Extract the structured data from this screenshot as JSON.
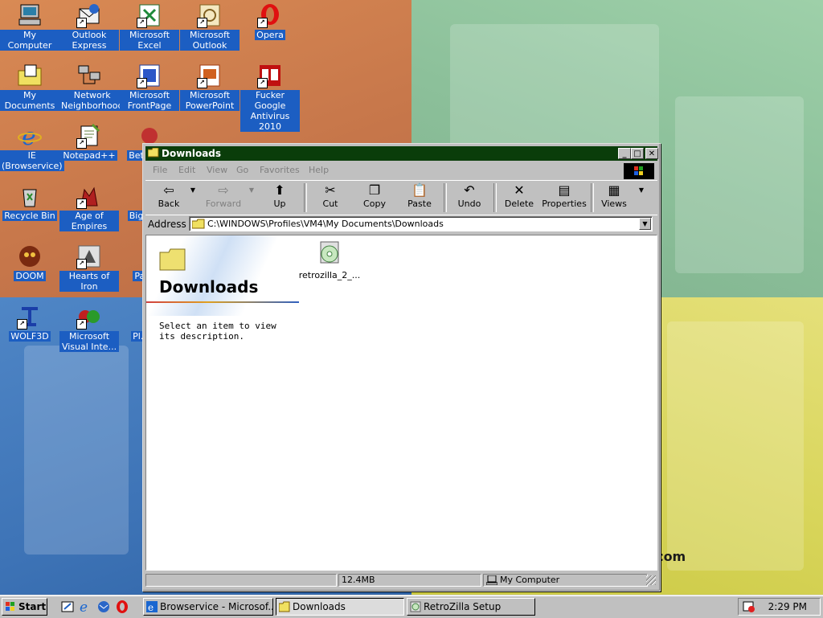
{
  "desktop": {
    "watermark": ".com",
    "icons": [
      {
        "label": "My Computer"
      },
      {
        "label": "Outlook Express"
      },
      {
        "label": "Microsoft Excel"
      },
      {
        "label": "Microsoft Outlook"
      },
      {
        "label": "Opera"
      },
      {
        "label": "My Documents"
      },
      {
        "label": "Network Neighborhood"
      },
      {
        "label": "Microsoft FrontPage"
      },
      {
        "label": "Microsoft PowerPoint"
      },
      {
        "label": "Fucker Google Antivirus 2010"
      },
      {
        "label": "IE (Browservice)"
      },
      {
        "label": "Notepad++"
      },
      {
        "label": "Bet... D..."
      },
      {
        "label": "Recycle Bin"
      },
      {
        "label": "Age of Empires"
      },
      {
        "label": "Big... D..."
      },
      {
        "label": "DOOM"
      },
      {
        "label": "Hearts of Iron"
      },
      {
        "label": "Pagg..."
      },
      {
        "label": "WOLF3D"
      },
      {
        "label": "Microsoft Visual Inte..."
      },
      {
        "label": "Pl... Z..."
      }
    ]
  },
  "window": {
    "title": "Downloads",
    "menu": [
      "File",
      "Edit",
      "View",
      "Go",
      "Favorites",
      "Help"
    ],
    "toolbar": {
      "back": "Back",
      "forward": "Forward",
      "up": "Up",
      "cut": "Cut",
      "copy": "Copy",
      "paste": "Paste",
      "undo": "Undo",
      "delete": "Delete",
      "properties": "Properties",
      "views": "Views"
    },
    "address_label": "Address",
    "address_value": "C:\\WINDOWS\\Profiles\\VM4\\My Documents\\Downloads",
    "web_panel": {
      "title": "Downloads",
      "description": "Select an item to view its description."
    },
    "files": [
      {
        "name": "retrozilla_2_..."
      }
    ],
    "status": {
      "size": "12.4MB",
      "location": "My Computer"
    }
  },
  "taskbar": {
    "start": "Start",
    "tasks": [
      {
        "label": "Browservice - Microsof..."
      },
      {
        "label": "Downloads"
      },
      {
        "label": "RetroZilla Setup"
      }
    ],
    "clock": "2:29 PM"
  }
}
